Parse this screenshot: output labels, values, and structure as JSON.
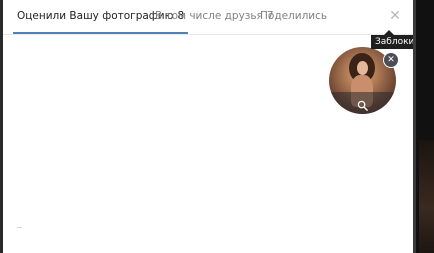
{
  "tabs": [
    {
      "label": "Оценили Вашу фотографию",
      "count": "8"
    },
    {
      "label": "В том числе друзья",
      "count": "7"
    },
    {
      "label": "Поделились",
      "count": ""
    }
  ],
  "tooltip": {
    "text": "Заблокировать"
  },
  "icons": {
    "close": "close-icon",
    "remove": "remove-icon",
    "zoom": "magnifier-icon"
  },
  "colors": {
    "accent": "#5181b8",
    "tooltip_bg": "#1f1f1f",
    "muted_text": "#828282"
  }
}
